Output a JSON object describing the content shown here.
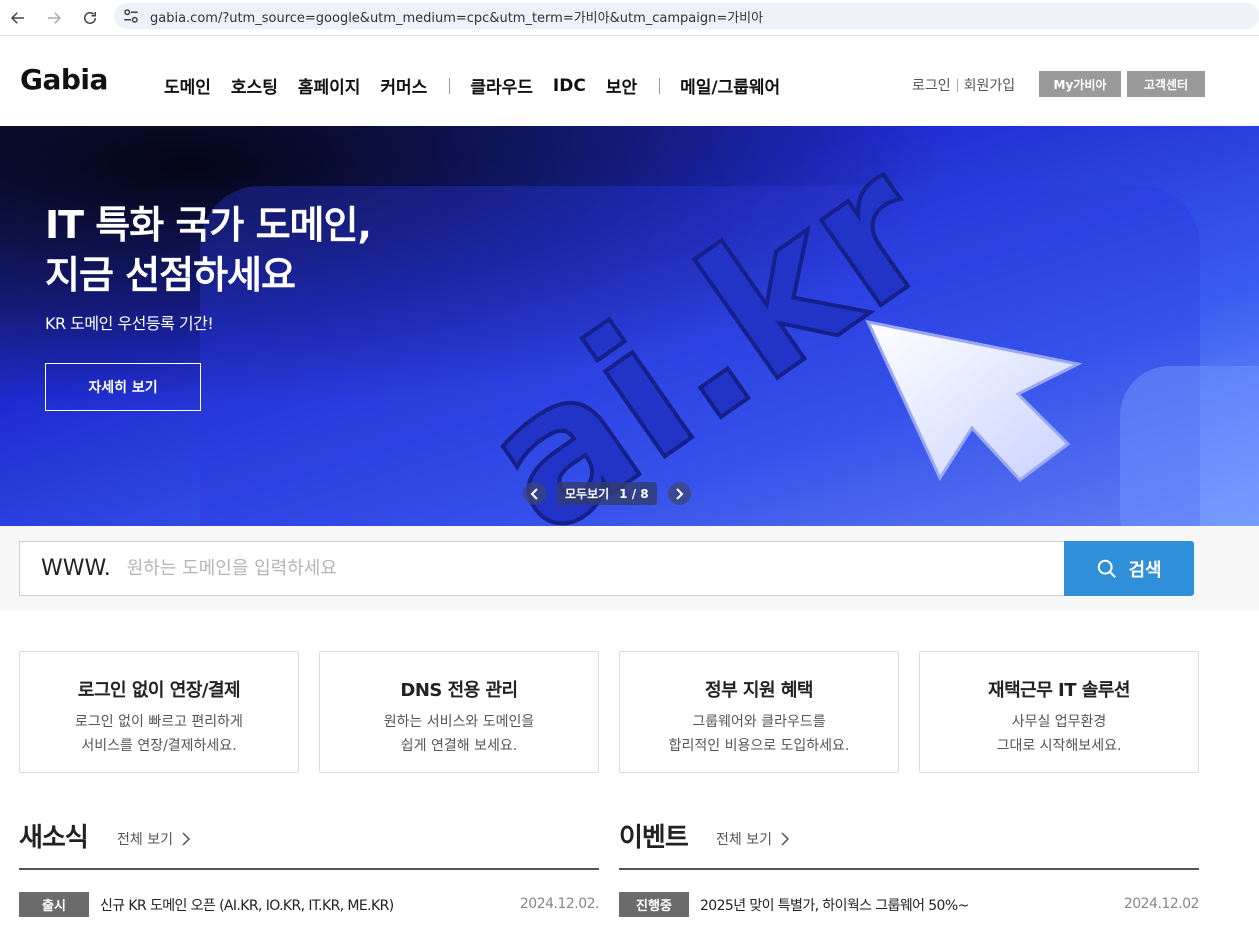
{
  "browser": {
    "url": "gabia.com/?utm_source=google&utm_medium=cpc&utm_term=가비아&utm_campaign=가비아"
  },
  "header": {
    "logo": "Gabia",
    "nav_group1": [
      "도메인",
      "호스팅",
      "홈페이지",
      "커머스"
    ],
    "nav_group2": [
      "클라우드",
      "IDC",
      "보안"
    ],
    "nav_group3": [
      "메일/그룹웨어"
    ],
    "login": "로그인",
    "signup": "회원가입",
    "my_gabia": "My가비아",
    "support": "고객센터"
  },
  "hero": {
    "title": "IT 특화 국가 도메인,\n지금 선점하세요",
    "subtitle": "KR 도메인 우선등록 기간!",
    "cta": "자세히 보기",
    "view_all": "모두보기",
    "page_count": "1 / 8",
    "art_text": "ai.kr"
  },
  "search": {
    "prefix": "WWW.",
    "placeholder": "원하는 도메인을 입력하세요",
    "button": "검색"
  },
  "cards": [
    {
      "title": "로그인 없이 연장/결제",
      "desc": "로그인 없이 빠르고 편리하게\n서비스를 연장/결제하세요."
    },
    {
      "title": "DNS 전용 관리",
      "desc": "원하는 서비스와 도메인을\n쉽게 연결해 보세요."
    },
    {
      "title": "정부 지원 혜택",
      "desc": "그룹웨어와 클라우드를\n합리적인 비용으로 도입하세요."
    },
    {
      "title": "재택근무 IT 솔루션",
      "desc": "사무실 업무환경\n그대로 시작해보세요."
    }
  ],
  "news": {
    "title": "새소식",
    "more": "전체 보기",
    "rows": [
      {
        "tag": "출시",
        "text": "신규 KR 도메인 오픈 (AI.KR, IO.KR, IT.KR, ME.KR)",
        "date": "2024.12.02."
      }
    ]
  },
  "events": {
    "title": "이벤트",
    "more": "전체 보기",
    "rows": [
      {
        "tag": "진행중",
        "text": "2025년 맞이 특별가, 하이웍스 그룹웨어 50%~",
        "date": "2024.12.02"
      }
    ]
  },
  "colors": {
    "search_button": "#2f8fd8",
    "hero_blue": "#2a32c8",
    "tag_gray": "#6b6b6b"
  }
}
